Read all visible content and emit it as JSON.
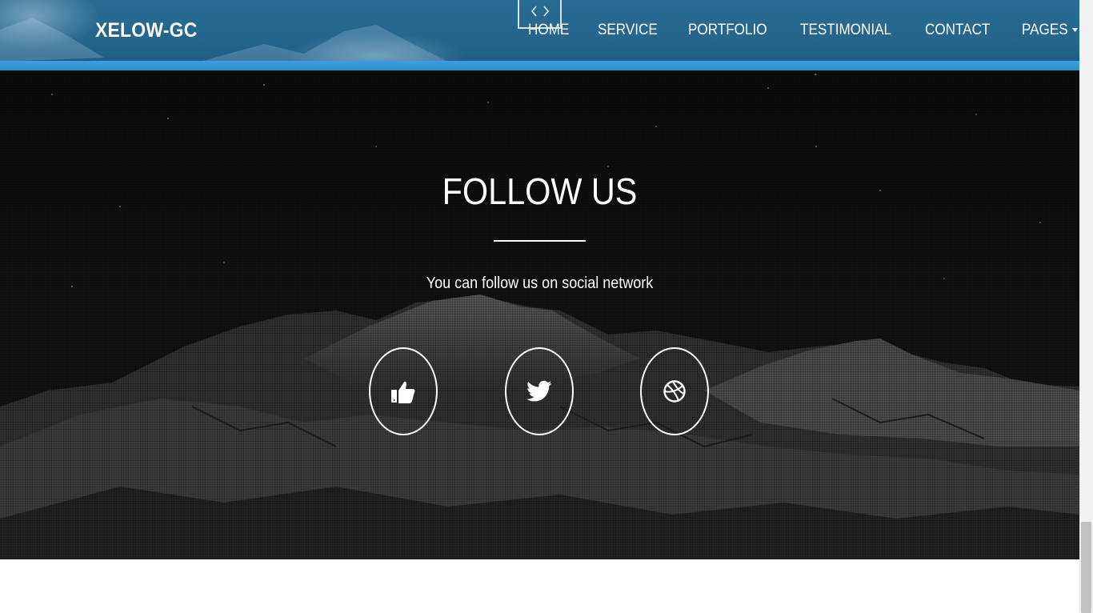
{
  "header": {
    "brand": "XELOW-GC",
    "nav": [
      {
        "label": "HOME"
      },
      {
        "label": "SERVICE"
      },
      {
        "label": "PORTFOLIO"
      },
      {
        "label": "TESTIMONIAL"
      },
      {
        "label": "CONTACT"
      },
      {
        "label": "PAGES",
        "has_dropdown": true
      }
    ],
    "code_toggle_icon": "code-icon"
  },
  "follow": {
    "title": "FOLLOW US",
    "subtitle": "You can follow us on social network",
    "social": [
      {
        "icon": "thumbs-up-icon"
      },
      {
        "icon": "twitter-icon"
      },
      {
        "icon": "dribbble-icon"
      }
    ]
  },
  "colors": {
    "header_bg": "#25658c",
    "header_stripe": "#3aa0de",
    "section_bg": "#141414",
    "text": "#ffffff"
  }
}
